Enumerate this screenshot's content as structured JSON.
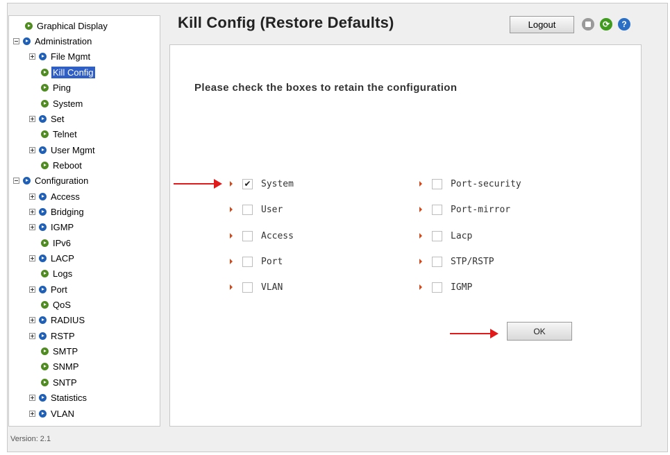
{
  "sidebar": {
    "items": [
      {
        "label": "Graphical Display",
        "level": 0,
        "toggle": "none",
        "icon": "green-arrow-icon",
        "selected": false
      },
      {
        "label": "Administration",
        "level": 0,
        "toggle": "minus",
        "icon": "blue-arrow-icon",
        "selected": false
      },
      {
        "label": "File Mgmt",
        "level": 1,
        "toggle": "plus",
        "icon": "blue-arrow-icon",
        "selected": false
      },
      {
        "label": "Kill Config",
        "level": 1,
        "toggle": "none",
        "icon": "green-arrow-icon",
        "selected": true
      },
      {
        "label": "Ping",
        "level": 1,
        "toggle": "none",
        "icon": "green-arrow-icon",
        "selected": false
      },
      {
        "label": "System",
        "level": 1,
        "toggle": "none",
        "icon": "green-arrow-icon",
        "selected": false
      },
      {
        "label": "Set",
        "level": 1,
        "toggle": "plus",
        "icon": "blue-arrow-icon",
        "selected": false
      },
      {
        "label": "Telnet",
        "level": 1,
        "toggle": "none",
        "icon": "green-arrow-icon",
        "selected": false
      },
      {
        "label": "User Mgmt",
        "level": 1,
        "toggle": "plus",
        "icon": "blue-arrow-icon",
        "selected": false
      },
      {
        "label": "Reboot",
        "level": 1,
        "toggle": "none",
        "icon": "green-arrow-icon",
        "selected": false
      },
      {
        "label": "Configuration",
        "level": 0,
        "toggle": "minus",
        "icon": "blue-arrow-icon",
        "selected": false
      },
      {
        "label": "Access",
        "level": 1,
        "toggle": "plus",
        "icon": "blue-arrow-icon",
        "selected": false
      },
      {
        "label": "Bridging",
        "level": 1,
        "toggle": "plus",
        "icon": "blue-arrow-icon",
        "selected": false
      },
      {
        "label": "IGMP",
        "level": 1,
        "toggle": "plus",
        "icon": "blue-arrow-icon",
        "selected": false
      },
      {
        "label": "IPv6",
        "level": 1,
        "toggle": "none",
        "icon": "green-arrow-icon",
        "selected": false
      },
      {
        "label": "LACP",
        "level": 1,
        "toggle": "plus",
        "icon": "blue-arrow-icon",
        "selected": false
      },
      {
        "label": "Logs",
        "level": 1,
        "toggle": "none",
        "icon": "green-arrow-icon",
        "selected": false
      },
      {
        "label": "Port",
        "level": 1,
        "toggle": "plus",
        "icon": "blue-arrow-icon",
        "selected": false
      },
      {
        "label": "QoS",
        "level": 1,
        "toggle": "none",
        "icon": "green-arrow-icon",
        "selected": false
      },
      {
        "label": "RADIUS",
        "level": 1,
        "toggle": "plus",
        "icon": "blue-arrow-icon",
        "selected": false
      },
      {
        "label": "RSTP",
        "level": 1,
        "toggle": "plus",
        "icon": "blue-arrow-icon",
        "selected": false
      },
      {
        "label": "SMTP",
        "level": 1,
        "toggle": "none",
        "icon": "green-arrow-icon",
        "selected": false
      },
      {
        "label": "SNMP",
        "level": 1,
        "toggle": "none",
        "icon": "green-arrow-icon",
        "selected": false
      },
      {
        "label": "SNTP",
        "level": 1,
        "toggle": "none",
        "icon": "green-arrow-icon",
        "selected": false
      },
      {
        "label": "Statistics",
        "level": 1,
        "toggle": "plus",
        "icon": "blue-arrow-icon",
        "selected": false
      },
      {
        "label": "VLAN",
        "level": 1,
        "toggle": "plus",
        "icon": "blue-arrow-icon",
        "selected": false
      }
    ]
  },
  "footer": {
    "version": "Version: 2.1"
  },
  "header": {
    "title": "Kill Config (Restore Defaults)",
    "logout_label": "Logout",
    "icons": [
      "save-icon",
      "refresh-icon",
      "help-icon"
    ]
  },
  "main": {
    "instruction": "Please check the boxes to retain the configuration",
    "left_options": [
      {
        "label": "System",
        "checked": true
      },
      {
        "label": "User",
        "checked": false
      },
      {
        "label": "Access",
        "checked": false
      },
      {
        "label": "Port",
        "checked": false
      },
      {
        "label": "VLAN",
        "checked": false
      }
    ],
    "right_options": [
      {
        "label": "Port-security",
        "checked": false
      },
      {
        "label": "Port-mirror",
        "checked": false
      },
      {
        "label": "Lacp",
        "checked": false
      },
      {
        "label": "STP/RSTP",
        "checked": false
      },
      {
        "label": "IGMP",
        "checked": false
      }
    ],
    "ok_label": "OK"
  },
  "colors": {
    "selection": "#2f5fc4",
    "folder_icon": "#1f5fb5",
    "leaf_icon": "#4f8b21",
    "option_arrow": "#d04a1c",
    "annotation_arrow": "#e01a1a"
  }
}
